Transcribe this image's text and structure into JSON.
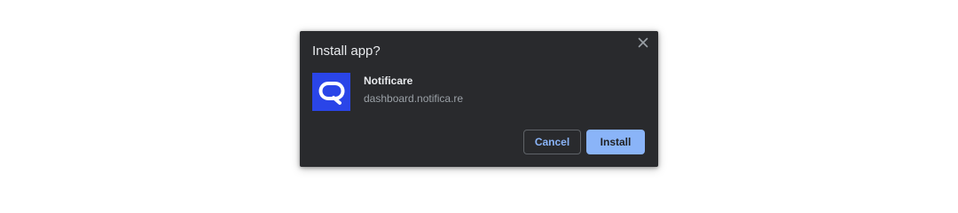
{
  "dialog": {
    "title": "Install app?",
    "close_icon": "close-icon"
  },
  "app": {
    "name": "Notificare",
    "origin": "dashboard.notifica.re",
    "icon": "notificare-logo-icon",
    "icon_bg": "#2a45e8"
  },
  "buttons": {
    "cancel_label": "Cancel",
    "install_label": "Install"
  },
  "colors": {
    "dialog_bg": "#292a2d",
    "accent": "#8ab4f8",
    "text_primary": "#e8eaed",
    "text_secondary": "#9aa0a6"
  }
}
